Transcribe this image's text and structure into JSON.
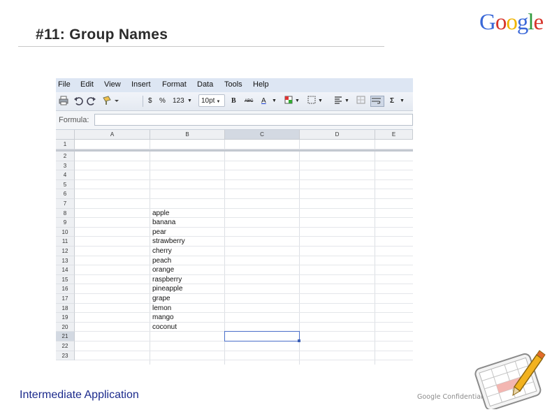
{
  "slide": {
    "title": "#11: Group Names",
    "footer_left": "Intermediate Application",
    "footer_right": "Google Confidential",
    "logo_letters": [
      "G",
      "o",
      "o",
      "g",
      "l",
      "e"
    ],
    "logo_colors": [
      "#3a68d8",
      "#d6352b",
      "#f0b400",
      "#3a68d8",
      "#2f9a3c",
      "#d6352b"
    ]
  },
  "sheet": {
    "menu": [
      "File",
      "Edit",
      "View",
      "Insert",
      "Format",
      "Data",
      "Tools",
      "Help"
    ],
    "toolbar": {
      "currency": "$",
      "percent": "%",
      "number_format": "123",
      "font_size": "10pt",
      "bold": "B",
      "strike": "ABC",
      "text_color": "A",
      "sum": "Σ"
    },
    "formula_label": "Formula:",
    "columns": [
      "A",
      "B",
      "C",
      "D",
      "E"
    ],
    "rows": [
      "1",
      "2",
      "3",
      "4",
      "5",
      "6",
      "7",
      "8",
      "9",
      "10",
      "11",
      "12",
      "13",
      "14",
      "15",
      "16",
      "17",
      "18",
      "19",
      "20",
      "21",
      "22",
      "23"
    ],
    "selected_row": "21",
    "selected_column": "C",
    "column_b_values": [
      "apple",
      "banana",
      "pear",
      "strawberry",
      "cherry",
      "peach",
      "orange",
      "raspberry",
      "pineapple",
      "grape",
      "lemon",
      "mango",
      "coconut"
    ],
    "icons": [
      "print-icon",
      "undo-icon",
      "redo-icon",
      "paint-format-icon",
      "borders-icon",
      "align-icon",
      "wrap-icon",
      "merge-icon",
      "bg-color-icon"
    ]
  }
}
